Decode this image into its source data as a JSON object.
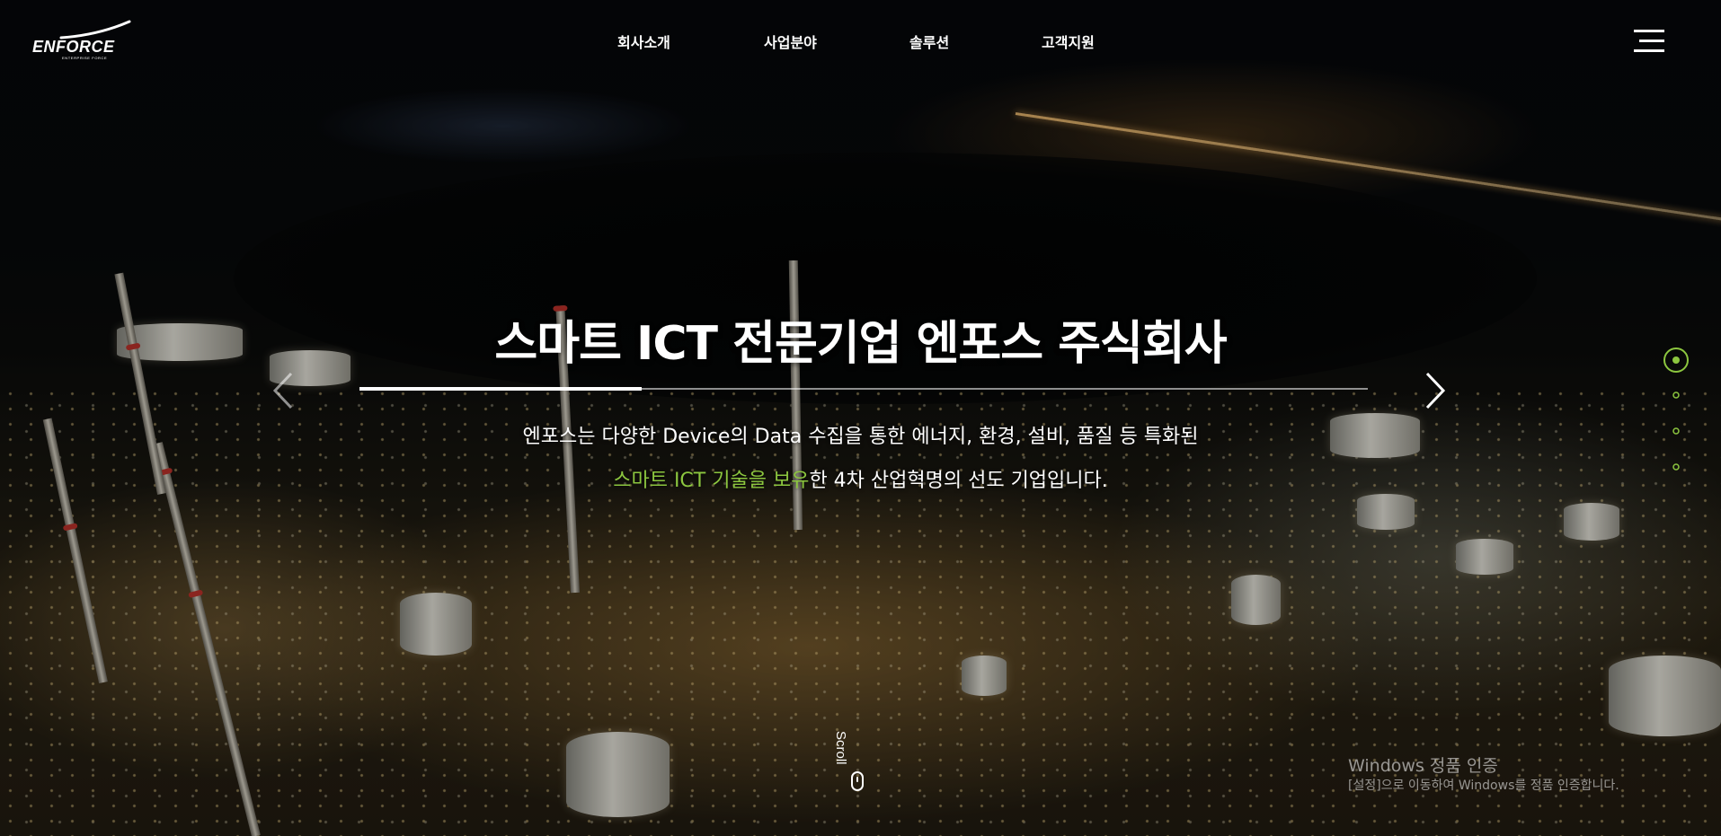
{
  "brand": {
    "logo_text": "ENFORCE",
    "logo_tagline": "ENTERPRISE FORCE"
  },
  "nav": {
    "items": [
      {
        "label": "회사소개"
      },
      {
        "label": "사업분야"
      },
      {
        "label": "솔루션"
      },
      {
        "label": "고객지원"
      }
    ],
    "menu_icon": "hamburger-icon"
  },
  "hero": {
    "headline": "스마트 ICT 전문기업 엔포스 주식회사",
    "line1": "엔포스는 다양한 Device의 Data 수집을 통한 에너지, 환경, 설비, 품질 등 특화된",
    "line2_highlight": "스마트 ICT 기술을 보유",
    "line2_rest": "한 4차 산업혁명의 선도 기업입니다.",
    "progress_fraction": 0.28,
    "prev_icon": "chevron-left-icon",
    "next_icon": "chevron-right-icon"
  },
  "pager": {
    "slide_count": 4,
    "active_index": 0
  },
  "scroll": {
    "label": "Scroll",
    "icon": "mouse-icon"
  },
  "watermark": {
    "title": "Windows 정품 인증",
    "subtitle": "[설정]으로 이동하여 Windows를 정품 인증합니다."
  },
  "colors": {
    "accent": "#8cc63f",
    "text": "#ffffff",
    "background": "#0a0b0c"
  }
}
